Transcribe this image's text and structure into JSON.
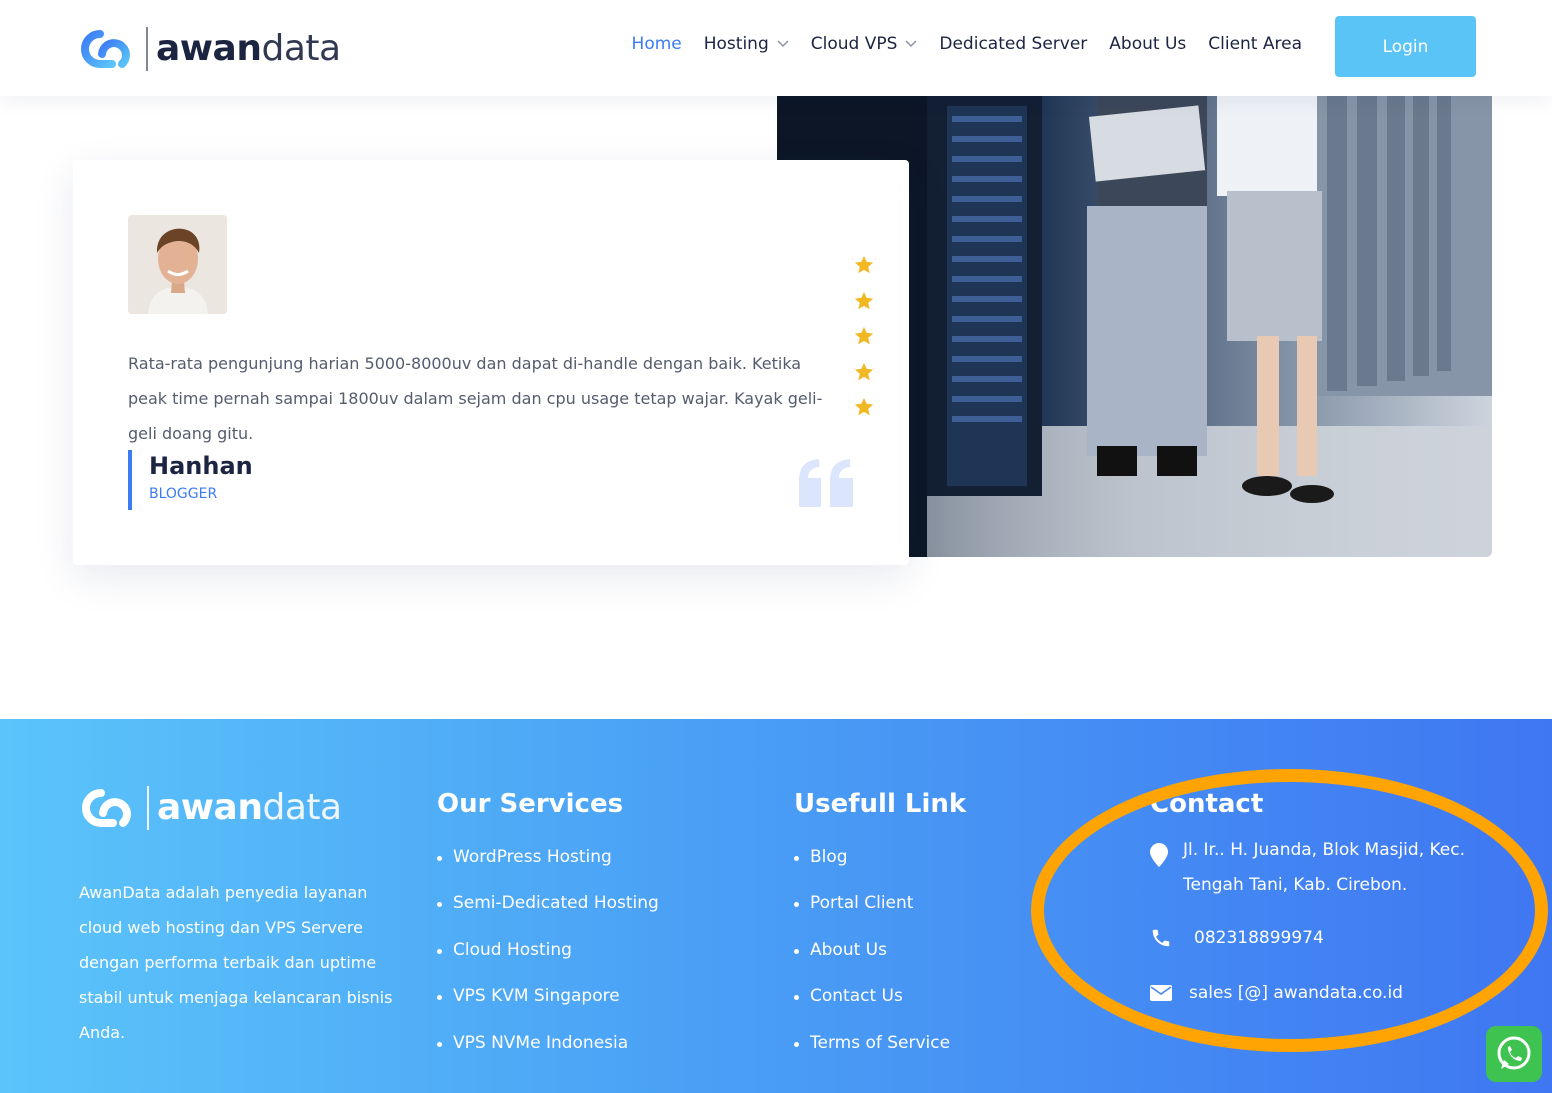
{
  "brand": {
    "name_bold": "awan",
    "name_light": "data"
  },
  "nav": {
    "items": [
      {
        "label": "Home",
        "active": true,
        "dropdown": false
      },
      {
        "label": "Hosting",
        "active": false,
        "dropdown": true
      },
      {
        "label": "Cloud VPS",
        "active": false,
        "dropdown": true
      },
      {
        "label": "Dedicated Server",
        "active": false,
        "dropdown": false
      },
      {
        "label": "About Us",
        "active": false,
        "dropdown": false
      },
      {
        "label": "Client Area",
        "active": false,
        "dropdown": false
      }
    ],
    "login_label": "Login"
  },
  "testimonial": {
    "rating": 5,
    "text": "Rata-rata pengunjung harian 5000-8000uv dan dapat di-handle dengan baik. Ketika peak time pernah sampai 1800uv dalam sejam dan cpu usage tetap wajar. Kayak geli-geli doang gitu.",
    "author_name": "Hanhan",
    "author_role": "BLOGGER"
  },
  "footer": {
    "about": "AwanData adalah penyedia layanan cloud web hosting dan VPS Servere dengan performa terbaik dan uptime stabil untuk menjaga kelancaran bisnis Anda.",
    "services_title": "Our Services",
    "services": [
      "WordPress Hosting",
      "Semi-Dedicated Hosting",
      "Cloud Hosting",
      "VPS KVM Singapore",
      "VPS NVMe Indonesia"
    ],
    "links_title": "Usefull Link",
    "links": [
      "Blog",
      "Portal Client",
      "About Us",
      "Contact Us",
      "Terms of Service"
    ],
    "contact_title": "Contact",
    "address": "Jl. Ir.. H. Juanda, Blok Masjid, Kec. Tengah Tani, Kab. Cirebon.",
    "phone": "082318899974",
    "email": "sales [@] awandata.co.id"
  },
  "colors": {
    "accent": "#3b7bf5",
    "login_bg": "#5bc4f7",
    "star": "#f2b824",
    "highlight": "#ffa402",
    "whatsapp": "#3fc350"
  }
}
